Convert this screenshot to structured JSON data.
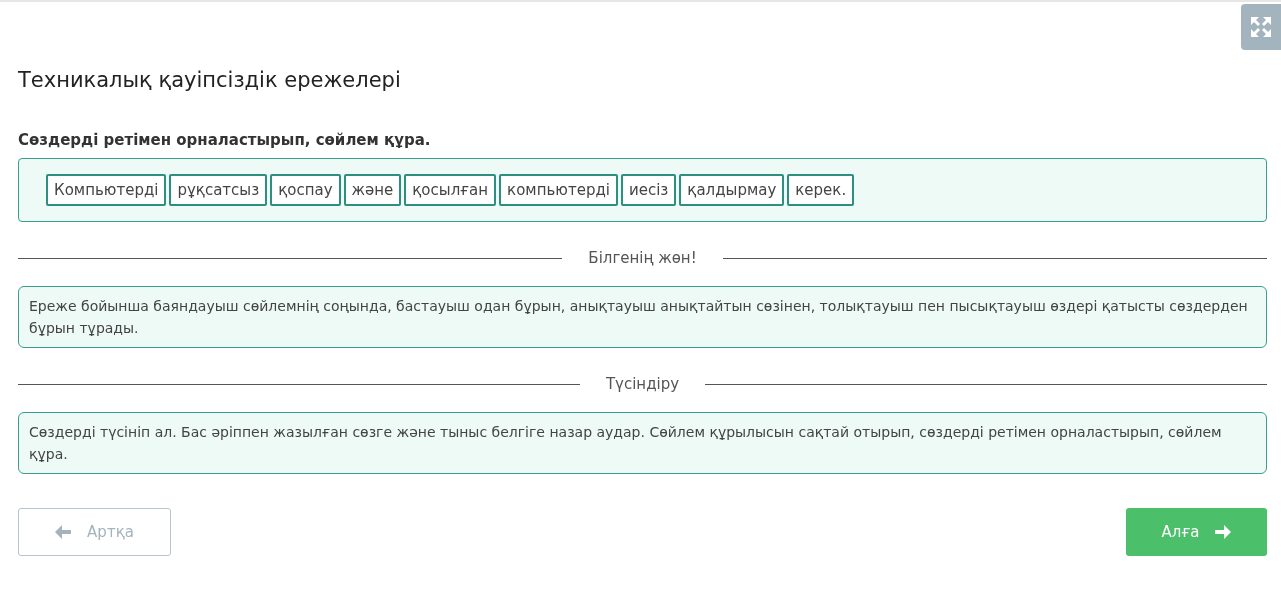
{
  "title": "Техникалық қауіпсіздік ережелері",
  "instruction": "Сөздерді ретімен орналастырып, сөйлем құра.",
  "words": [
    "Компьютерді",
    "рұқсатсыз",
    "қоспау",
    "және",
    "қосылған",
    "компьютерді",
    "иесіз",
    "қалдырмау",
    "керек."
  ],
  "sections": [
    {
      "heading": "Білгенің жөн!",
      "text": "Ереже бойынша баяндауыш сөйлемнің соңында, бастауыш одан бұрын, анықтауыш анықтайтын сөзінен, толықтауыш пен пысықтауыш өздері қатысты сөздерден бұрын тұрады."
    },
    {
      "heading": "Түсіндіру",
      "text": "Сөздерді түсініп ал. Бас әріппен жазылған сөзге және тыныс белгіге назар аудар. Сөйлем құрылысын сақтай отырып, сөздерді ретімен орналастырып, сөйлем құра."
    }
  ],
  "back_button": {
    "label": "Артқа",
    "disabled": true
  },
  "next_button": {
    "label": "Алға",
    "disabled": false
  }
}
